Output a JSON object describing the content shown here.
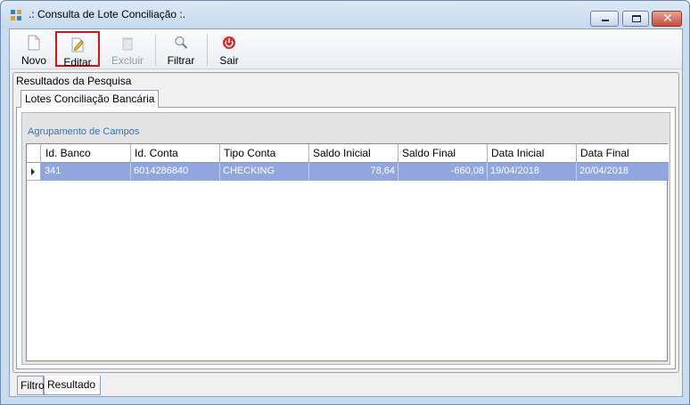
{
  "window": {
    "title": ".: Consulta de Lote Conciliação :.",
    "controls": {
      "close_glyph": "✕"
    }
  },
  "toolbar": {
    "items": [
      {
        "label": "Novo",
        "icon": "new-document-icon",
        "enabled": true
      },
      {
        "label": "Editar",
        "icon": "edit-pencil-icon",
        "enabled": true,
        "focused": true
      },
      {
        "label": "Excluir",
        "icon": "delete-trash-icon",
        "enabled": false
      },
      {
        "label": "Filtrar",
        "icon": "search-magnifier-icon",
        "enabled": true
      },
      {
        "label": "Sair",
        "icon": "power-exit-icon",
        "enabled": true
      }
    ]
  },
  "results": {
    "title": "Resultados da Pesquisa",
    "tab_label": "Lotes Conciliação Bancária",
    "group_label": "Agrupamento de Campos",
    "columns": [
      "Id. Banco",
      "Id. Conta",
      "Tipo Conta",
      "Saldo Inicial",
      "Saldo Final",
      "Data Inicial",
      "Data Final"
    ],
    "rows": [
      {
        "cells": [
          "341",
          "6014286840",
          "CHECKING",
          "78,64",
          "-660,08",
          "19/04/2018",
          "20/04/2018"
        ],
        "selected": true
      }
    ]
  },
  "bottom_tabs": [
    {
      "label": "Filtro",
      "active": false
    },
    {
      "label": "Resultado",
      "active": true
    }
  ],
  "colors": {
    "selected_row": "#91a6e0",
    "group_label": "#2a76b8",
    "focus_border": "#e01010"
  }
}
